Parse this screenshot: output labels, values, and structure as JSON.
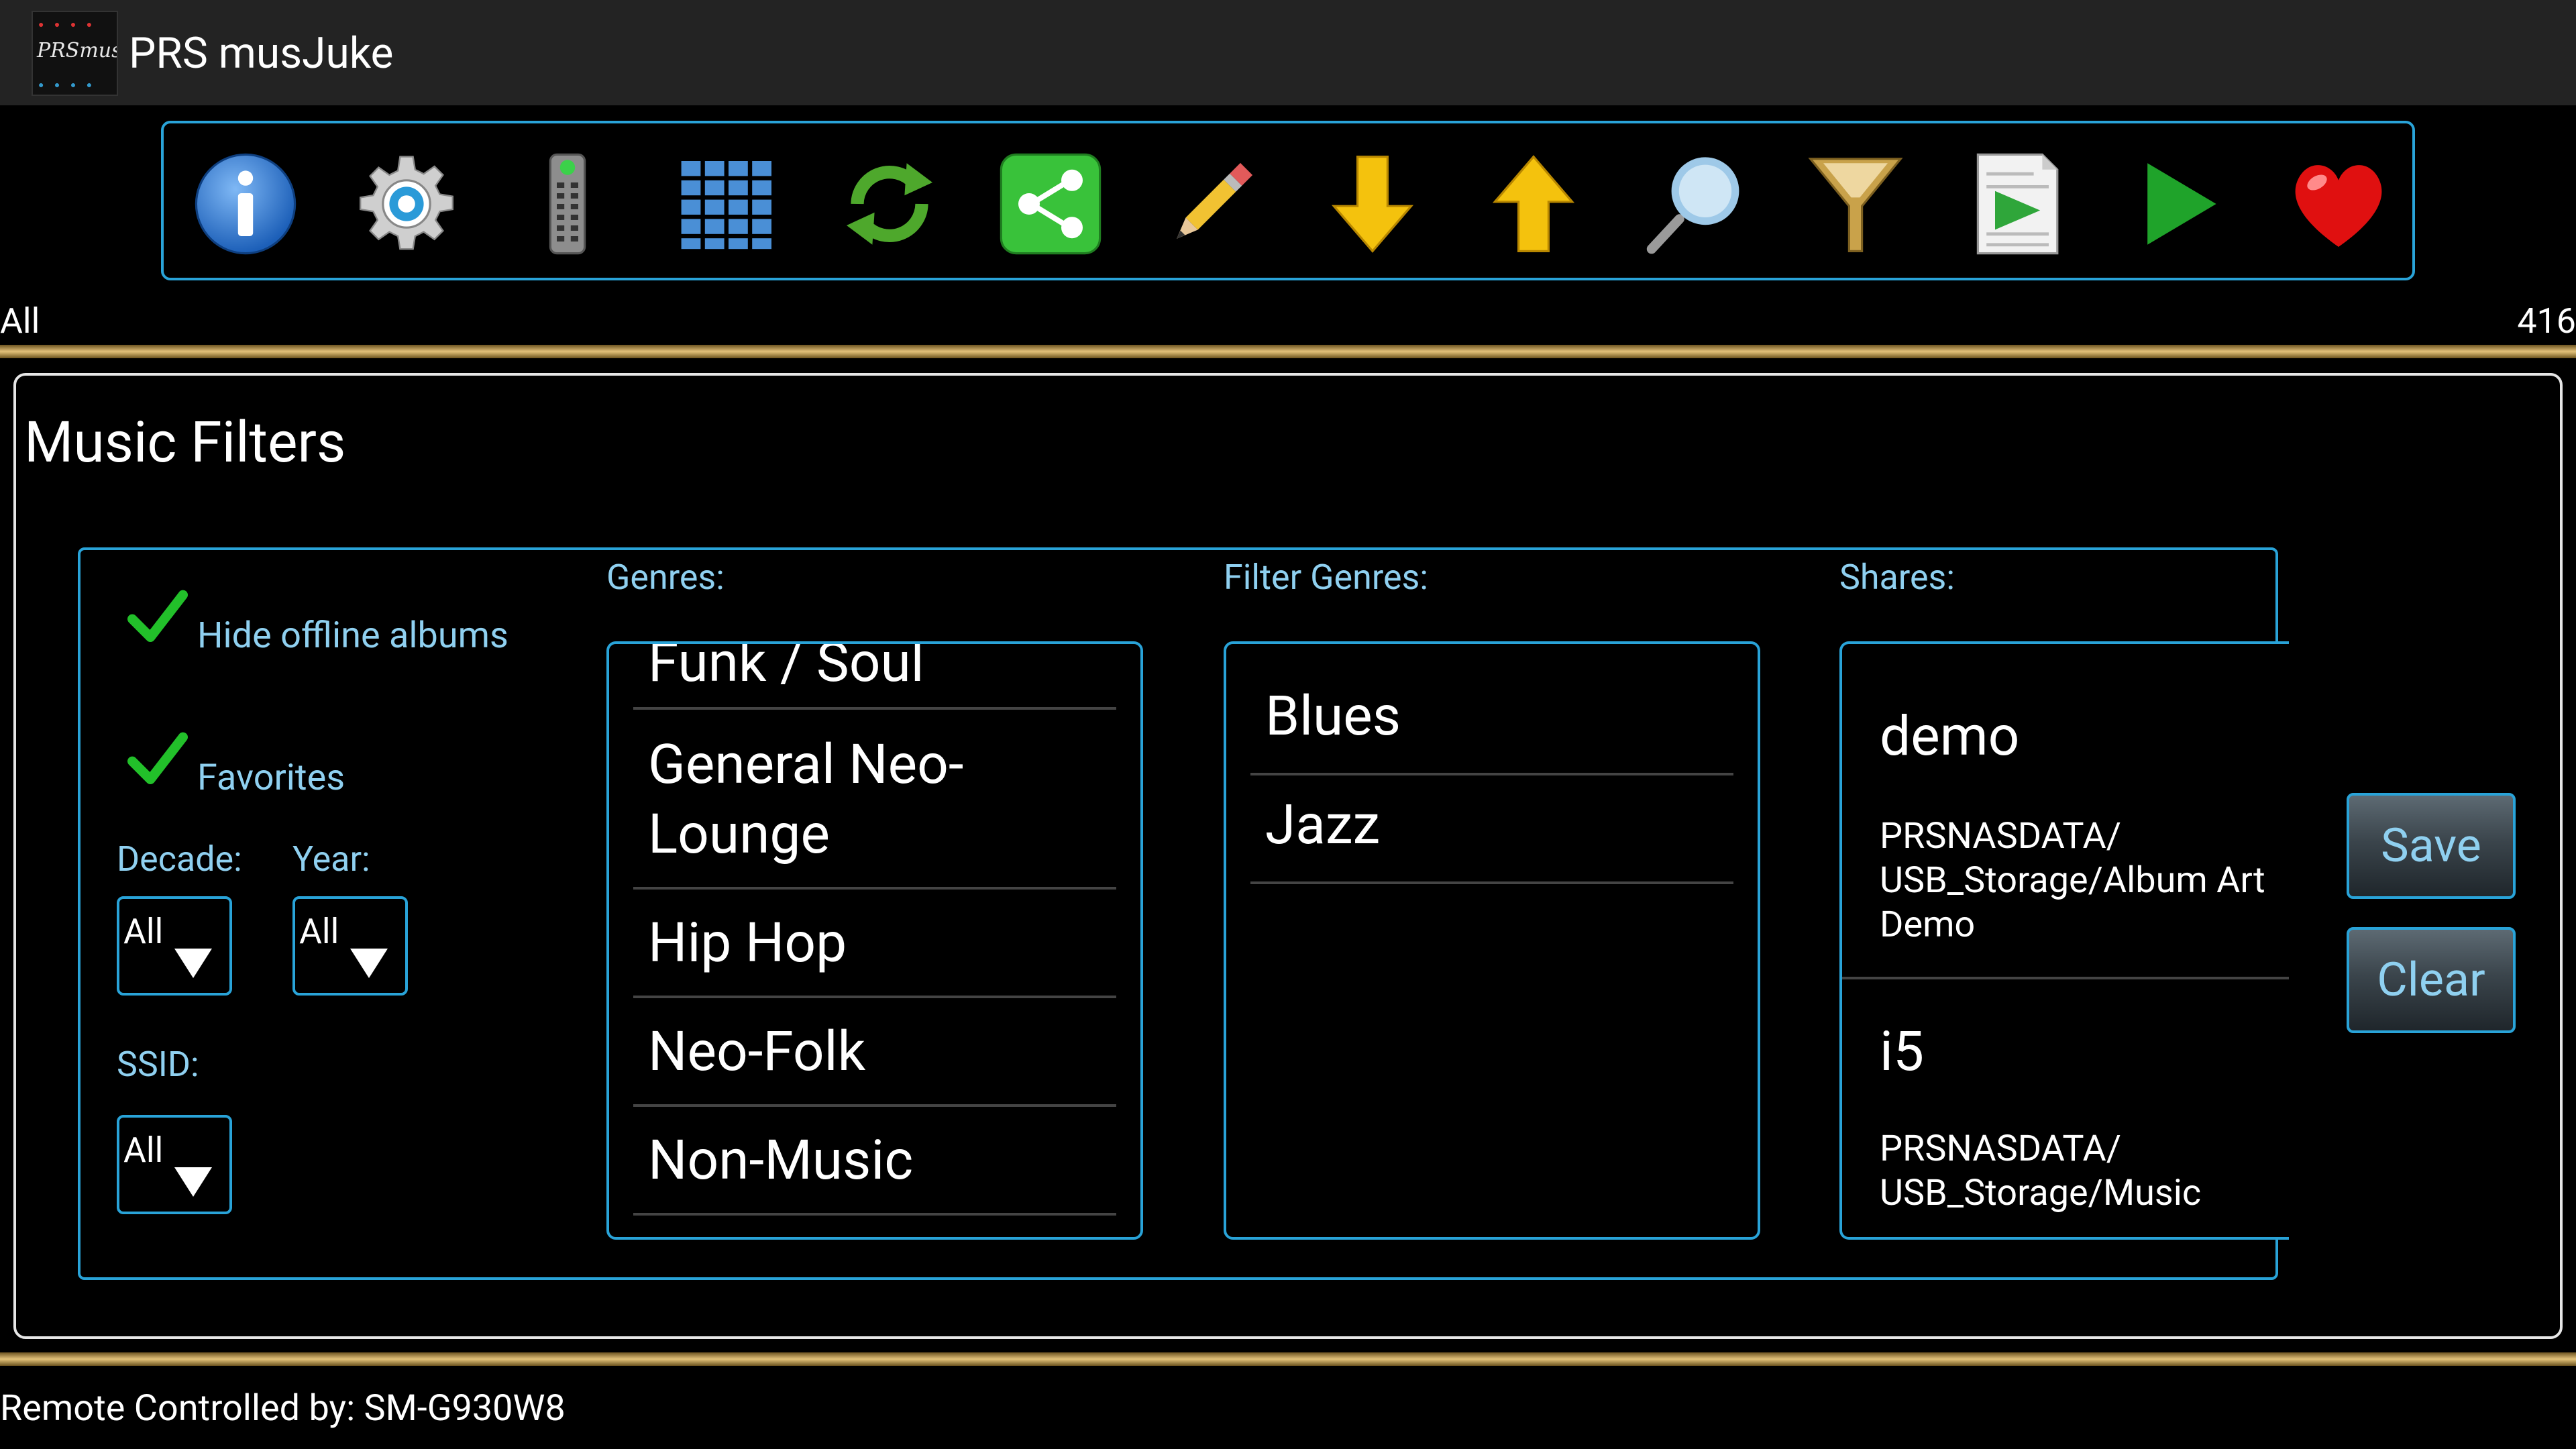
{
  "app": {
    "title": "PRS musJuke",
    "logo_text": "PRSmusJuke"
  },
  "toolbar": [
    {
      "name": "info-icon",
      "color": "#2f7fd8"
    },
    {
      "name": "gear-icon",
      "color": "#c9c9c9"
    },
    {
      "name": "remote-icon",
      "color": "#8a8a8a"
    },
    {
      "name": "grid-icon",
      "color": "#4a8fd6"
    },
    {
      "name": "refresh-icon",
      "color": "#4ea82c"
    },
    {
      "name": "share-icon",
      "color": "#39c23a"
    },
    {
      "name": "pencil-icon",
      "color": "#f1c232"
    },
    {
      "name": "arrow-down-icon",
      "color": "#f4c20d"
    },
    {
      "name": "arrow-up-icon",
      "color": "#f4c20d"
    },
    {
      "name": "magnifier-icon",
      "color": "#9ec9e8"
    },
    {
      "name": "funnel-icon",
      "color": "#c9a24a"
    },
    {
      "name": "playlist-icon",
      "color": "#2fa63a"
    },
    {
      "name": "play-icon",
      "color": "#1fa32a"
    },
    {
      "name": "heart-icon",
      "color": "#e01010"
    }
  ],
  "status": {
    "filter": "All",
    "count": "416"
  },
  "dialog": {
    "title": "Music Filters",
    "hide_offline_label": "Hide offline albums",
    "favorites_label": "Favorites",
    "decade_label": "Decade:",
    "decade_value": "All",
    "year_label": "Year:",
    "year_value": "All",
    "ssid_label": "SSID:",
    "ssid_value": "All",
    "genres_label": "Genres:",
    "genres": [
      "Funk / Soul",
      "General Neo-Lounge",
      "Hip Hop",
      "Neo-Folk",
      "Non-Music"
    ],
    "filter_genres_label": "Filter Genres:",
    "filter_genres": [
      "Blues",
      "Jazz"
    ],
    "shares_label": "Shares:",
    "shares": [
      {
        "name": "demo",
        "path": "PRSNASDATA/ USB_Storage/Album Art Demo"
      },
      {
        "name": "i5",
        "path": "PRSNASDATA/ USB_Storage/Music"
      }
    ],
    "save_label": "Save",
    "clear_label": "Clear"
  },
  "footer": {
    "remote_status": "Remote Controlled by: SM-G930W8"
  }
}
